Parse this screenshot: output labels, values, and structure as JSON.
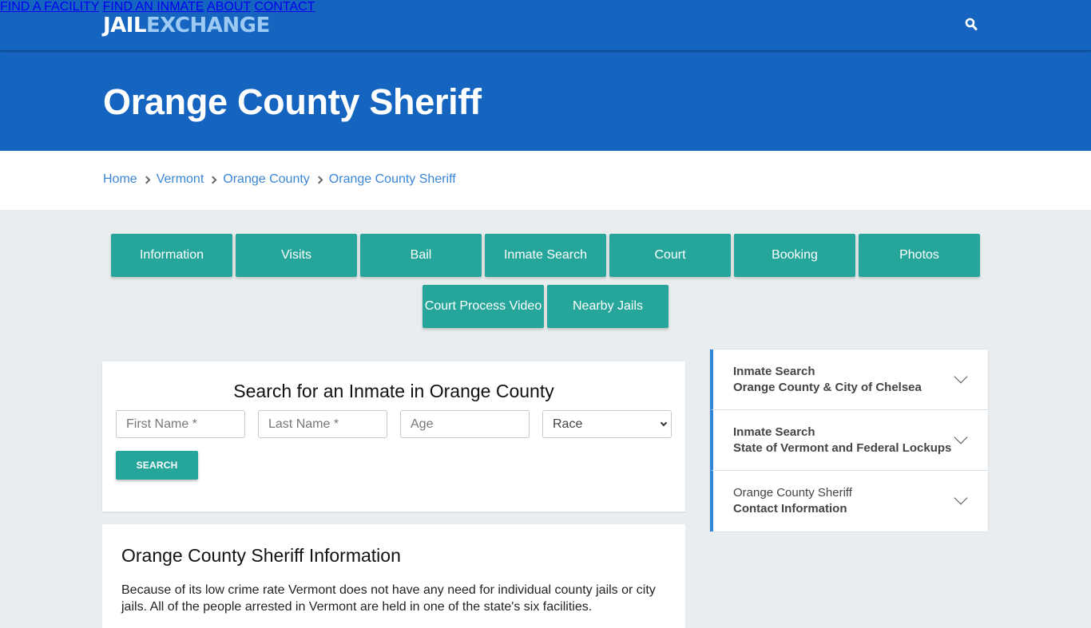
{
  "header": {
    "logo_part1": "JAIL",
    "logo_part2": "EXCHANGE",
    "nav": [
      {
        "label": "FIND A FACILITY"
      },
      {
        "label": "FIND AN INMATE"
      },
      {
        "label": "ABOUT"
      },
      {
        "label": "CONTACT"
      }
    ],
    "search_icon": "search-icon"
  },
  "hero": {
    "title": "Orange County Sheriff"
  },
  "breadcrumb": [
    {
      "label": "Home"
    },
    {
      "label": "Vermont"
    },
    {
      "label": "Orange County"
    },
    {
      "label": "Orange County Sheriff"
    }
  ],
  "tabs": [
    {
      "label": "Information"
    },
    {
      "label": "Visits"
    },
    {
      "label": "Bail"
    },
    {
      "label": "Inmate Search"
    },
    {
      "label": "Court"
    },
    {
      "label": "Booking"
    },
    {
      "label": "Photos"
    },
    {
      "label": "Court Process Video"
    },
    {
      "label": "Nearby Jails"
    }
  ],
  "search_form": {
    "title": "Search for an Inmate in Orange County",
    "first_name_placeholder": "First Name *",
    "last_name_placeholder": "Last Name *",
    "age_placeholder": "Age",
    "race_selected": "Race",
    "submit_label": "SEARCH"
  },
  "info": {
    "title": "Orange County Sheriff Information",
    "body": "Because of its low crime rate Vermont does not have any need for individual county jails or city jails. All of the people arrested in Vermont are held in one of the state's six facilities."
  },
  "sidebar": {
    "items": [
      {
        "line1": "Inmate Search",
        "line2": "Orange County & City of Chelsea"
      },
      {
        "line1": "Inmate Search",
        "line2": "State of Vermont and Federal Lockups"
      },
      {
        "line1": "Orange County Sheriff",
        "line2": "Contact Information"
      }
    ]
  },
  "colors": {
    "brand_blue": "#1565c0",
    "logo_accent": "#9ccaf3",
    "teal_button": "#26a69a",
    "link_blue": "#3b86d4",
    "page_bg": "#e9edf0"
  }
}
